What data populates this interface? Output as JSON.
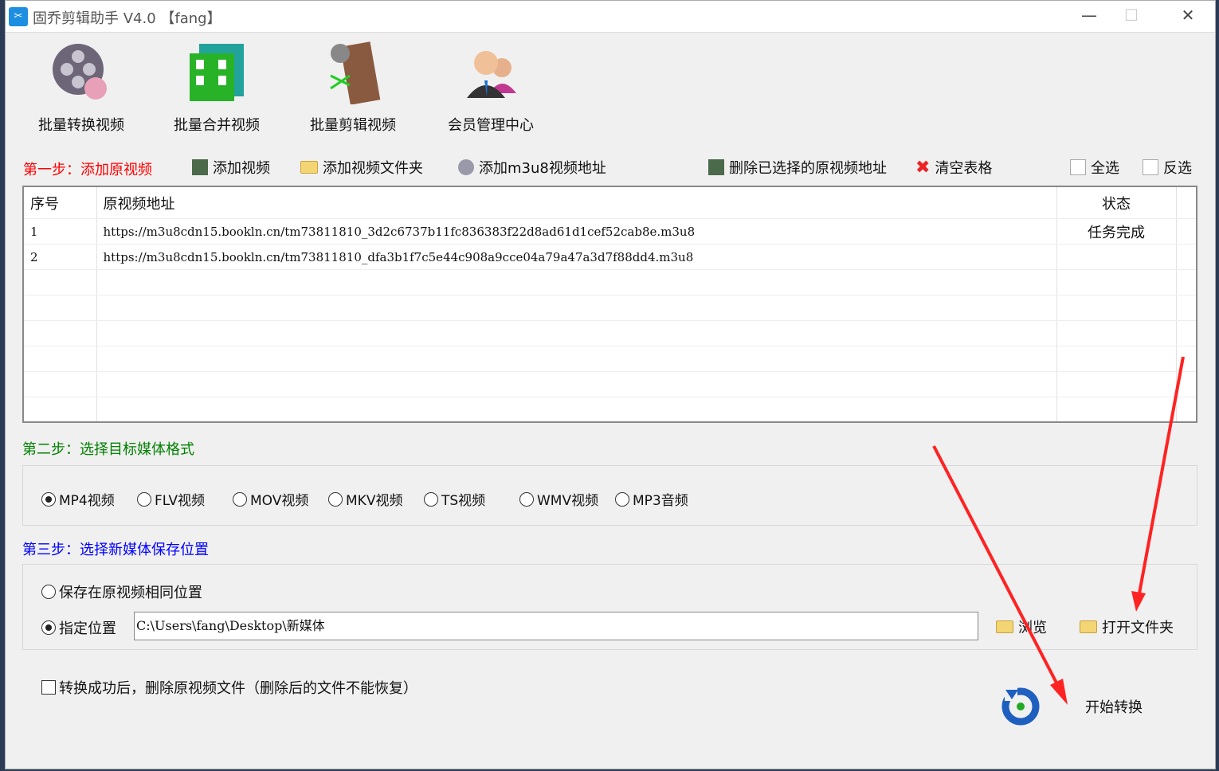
{
  "window": {
    "title": "固乔剪辑助手 V4.0 【fang】",
    "app_icon": "scissors-icon"
  },
  "tools": [
    {
      "label": "批量转换视频",
      "icon": "film-reel-convert-icon"
    },
    {
      "label": "批量合并视频",
      "icon": "film-merge-icon"
    },
    {
      "label": "批量剪辑视频",
      "icon": "film-cut-icon"
    },
    {
      "label": "会员管理中心",
      "icon": "members-icon"
    }
  ],
  "step1": {
    "label": "第一步：添加原视频",
    "color": "#ff0000",
    "buttons": {
      "add_video": "添加视频",
      "add_folder": "添加视频文件夹",
      "add_m3u8": "添加m3u8视频地址",
      "delete_selected": "删除已选择的原视频地址",
      "clear": "清空表格",
      "select_all": "全选",
      "invert": "反选"
    }
  },
  "table": {
    "headers": [
      "序号",
      "原视频地址",
      "状态"
    ],
    "rows": [
      {
        "no": "1",
        "url": "https://m3u8cdn15.bookln.cn/tm73811810_3d2c6737b11fc836383f22d8ad61d1cef52cab8e.m3u8",
        "status": "任务完成"
      },
      {
        "no": "2",
        "url": "https://m3u8cdn15.bookln.cn/tm73811810_dfa3b1f7c5e44c908a9cce04a79a47a3d7f88dd4.m3u8",
        "status": ""
      }
    ]
  },
  "step2": {
    "label": "第二步：选择目标媒体格式",
    "color": "#008000",
    "formats": [
      "MP4视频",
      "FLV视频",
      "MOV视频",
      "MKV视频",
      "TS视频",
      "WMV视频",
      "MP3音频"
    ],
    "selected": "MP4视频"
  },
  "step3": {
    "label": "第三步：选择新媒体保存位置",
    "color": "#0000ff",
    "same_location": "保存在原视频相同位置",
    "custom_location": "指定位置",
    "selected": "指定位置",
    "path": "C:\\Users\\fang\\Desktop\\新媒体",
    "browse": "浏览",
    "open_folder": "打开文件夹"
  },
  "delete_after": {
    "label": "转换成功后，删除原视频文件（删除后的文件不能恢复）",
    "checked": false
  },
  "start": {
    "label": "开始转换"
  }
}
